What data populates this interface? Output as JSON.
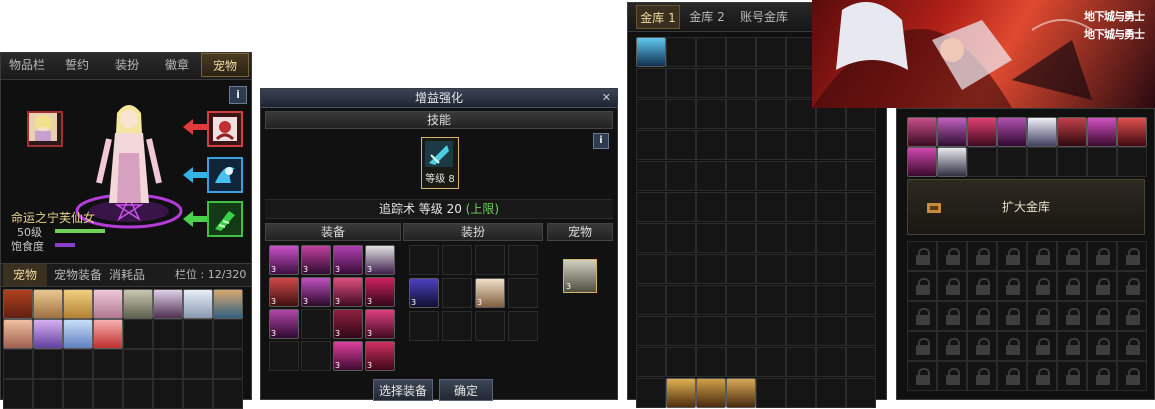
{
  "panel1": {
    "tabs": [
      "物品栏",
      "誓约",
      "装扮",
      "徽章",
      "宠物"
    ],
    "info": "i",
    "pet_name": "命运之宁芙仙女",
    "level": "50级",
    "hunger_label": "饱食度",
    "bottom_tabs": [
      "宠物",
      "宠物装备",
      "消耗品"
    ],
    "slots_label": "栏位 : 12/320"
  },
  "panel2": {
    "title": "增益强化",
    "close": "✕",
    "skill_header": "技能",
    "info": "i",
    "skill_level": "等级 8",
    "skill_desc": "追踪术 等级 20",
    "skill_max": "(上限)",
    "sections": [
      "装备",
      "装扮",
      "宠物"
    ],
    "select_button": "选择装备",
    "confirm_button": "确定"
  },
  "panel3": {
    "tabs": [
      "金库 1",
      "金库 2",
      "账号金库"
    ]
  },
  "panel4": {
    "logo1": "地下城与勇士",
    "logo2": "地下城与勇士",
    "expand_button": "扩大金库"
  },
  "colors": {
    "panel_bg": "#101010",
    "accent_gold": "#d6b36a",
    "green": "#6fd05a",
    "purple": "#8a3fc8"
  }
}
